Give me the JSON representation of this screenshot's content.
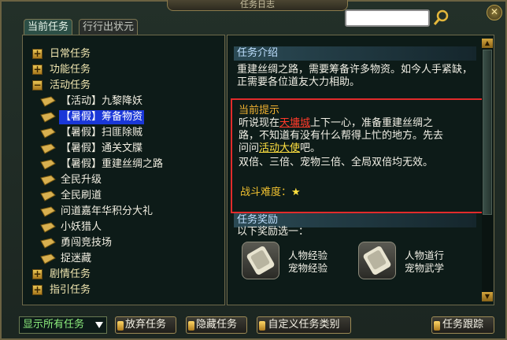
{
  "window": {
    "title": "任务日志"
  },
  "tabs": [
    {
      "label": "当前任务",
      "active": true
    },
    {
      "label": "行行出状元",
      "active": false
    }
  ],
  "tree": [
    {
      "type": "category",
      "label": "日常任务",
      "expanded": false
    },
    {
      "type": "category",
      "label": "功能任务",
      "expanded": false
    },
    {
      "type": "category",
      "label": "活动任务",
      "expanded": true
    },
    {
      "type": "quest",
      "label": "【活动】九黎降妖",
      "selected": false
    },
    {
      "type": "quest",
      "label": "【暑假】筹备物资",
      "selected": true
    },
    {
      "type": "quest",
      "label": "【暑假】扫匪除贼",
      "selected": false
    },
    {
      "type": "quest",
      "label": "【暑假】通关文牒",
      "selected": false
    },
    {
      "type": "quest",
      "label": "【暑假】重建丝绸之路",
      "selected": false
    },
    {
      "type": "quest",
      "label": "全民升级",
      "selected": false
    },
    {
      "type": "quest",
      "label": "全民刷道",
      "selected": false
    },
    {
      "type": "quest",
      "label": "问道嘉年华积分大礼",
      "selected": false
    },
    {
      "type": "quest",
      "label": "小妖猎人",
      "selected": false
    },
    {
      "type": "quest",
      "label": "勇闯竞技场",
      "selected": false
    },
    {
      "type": "quest",
      "label": "捉迷藏",
      "selected": false
    },
    {
      "type": "category",
      "label": "剧情任务",
      "expanded": false
    },
    {
      "type": "category",
      "label": "指引任务",
      "expanded": false
    }
  ],
  "detail": {
    "intro_header": "任务介绍",
    "intro_text": "重建丝绸之路，需要筹备许多物资。如今人手紧缺，正需要各位道友大力相助。",
    "hint_header": "当前提示",
    "hint_part1": "听说现在",
    "hint_place": "天墉城",
    "hint_part2": "上下一心，准备重建丝绸之路，不知道有没有什么帮得上忙的地方。先去问问",
    "hint_npc": "活动大使",
    "hint_part3": "吧。",
    "hint_bonus": "双倍、三倍、宠物三倍、全局双倍均无效。",
    "difficulty_label": "战斗难度：",
    "difficulty_stars": 1,
    "reward_header": "任务奖励",
    "reward_choose": "以下奖励选一：",
    "rewards": [
      {
        "line1": "人物经验",
        "line2": "宠物经验",
        "icon": "scroll-icon"
      },
      {
        "line1": "人物道行",
        "line2": "宠物武学",
        "icon": "scroll-icon"
      }
    ]
  },
  "footer": {
    "filter_value": "显示所有任务",
    "abandon_label": "放弃任务",
    "hide_label": "隐藏任务",
    "custom_label": "自定义任务类别",
    "track_label": "任务跟踪"
  },
  "colors": {
    "selected_bg": "#1a37d8",
    "hint_border": "#e22b2b",
    "place_red": "#ff3a2a",
    "npc_yellow": "#ffe040"
  }
}
